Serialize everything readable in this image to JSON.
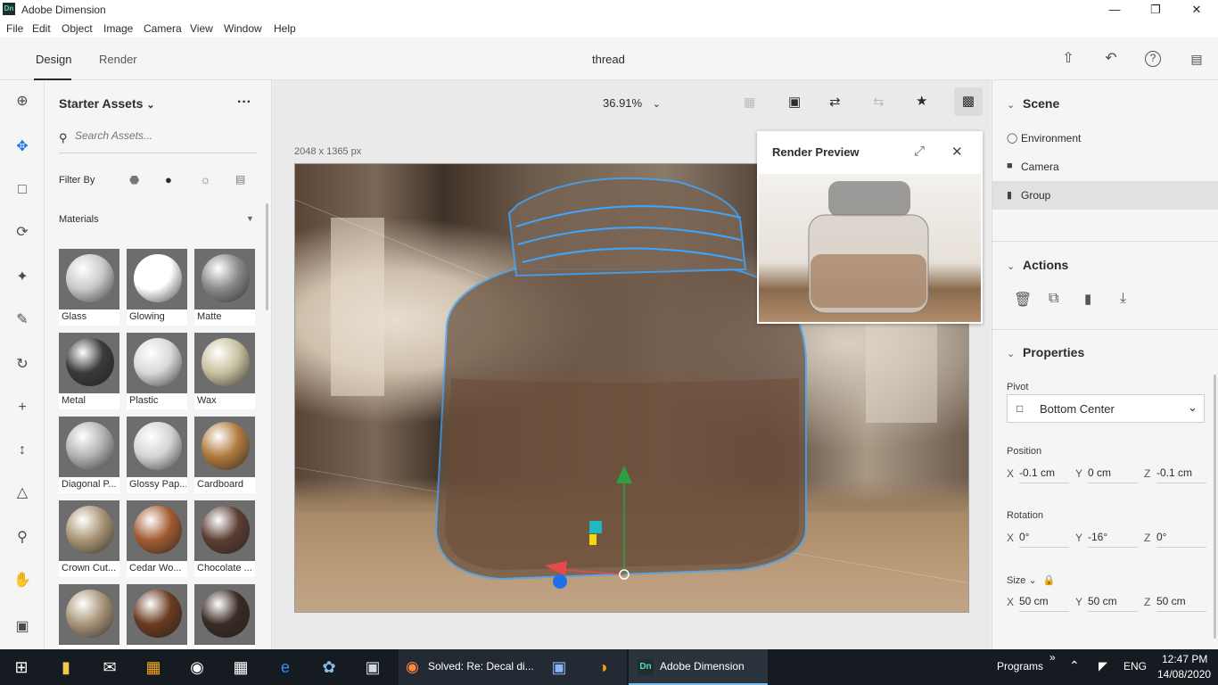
{
  "window": {
    "app_logo": "Dn",
    "title": "Adobe Dimension",
    "minimize_icon": "minimize-icon",
    "restore_icon": "restore-icon",
    "close_icon": "close-icon"
  },
  "menu": [
    "File",
    "Edit",
    "Object",
    "Image",
    "Camera",
    "View",
    "Window",
    "Help"
  ],
  "header": {
    "tabs": [
      "Design",
      "Render"
    ],
    "active_tab": "Design",
    "document_title": "thread",
    "icons": [
      "share-icon",
      "undo-icon",
      "help-icon",
      "comment-icon"
    ]
  },
  "tools": [
    "add-icon",
    "select-icon",
    "select-rect-icon",
    "orbit-icon",
    "magic-wand-icon",
    "eyedropper-icon",
    "rotate-icon",
    "move-icon",
    "scale-icon",
    "camera-orbit-icon",
    "zoom-icon",
    "hand-icon",
    "panel-toggle-icon"
  ],
  "assets": {
    "title": "Starter Assets",
    "more_label": "···",
    "search_placeholder": "Search Assets...",
    "filter_label": "Filter By",
    "filter_icons": [
      "model-filter-icon",
      "material-filter-icon",
      "light-filter-icon",
      "image-filter-icon"
    ],
    "section": "Materials",
    "materials": [
      {
        "label": "Glass",
        "color": "#c9c9c9"
      },
      {
        "label": "Glowing",
        "color": "#ffffff"
      },
      {
        "label": "Matte",
        "color": "#8a8a8a"
      },
      {
        "label": "Metal",
        "color": "#3a3a3a"
      },
      {
        "label": "Plastic",
        "color": "#d9d9d9"
      },
      {
        "label": "Wax",
        "color": "#c9c2a0"
      },
      {
        "label": "Diagonal P...",
        "color": "#b3b3b3"
      },
      {
        "label": "Glossy Pap...",
        "color": "#d4d4d4"
      },
      {
        "label": "Cardboard",
        "color": "#b07a3c"
      },
      {
        "label": "Crown Cut...",
        "color": "#a89474"
      },
      {
        "label": "Cedar Wo...",
        "color": "#a15a30"
      },
      {
        "label": "Chocolate ...",
        "color": "#5b3e32"
      },
      {
        "label": "",
        "color": "#a89478"
      },
      {
        "label": "",
        "color": "#6a3a20"
      },
      {
        "label": "",
        "color": "#3a2a24"
      }
    ]
  },
  "canvas": {
    "zoom": "36.91%",
    "size_label": "2048 x 1365 px",
    "toolbar_icons": [
      "frame-icon",
      "fit-icon",
      "camera-bookmark-icon",
      "camera-link-icon",
      "favorite-camera-icon",
      "render-preview-icon"
    ]
  },
  "render_preview": {
    "title": "Render Preview",
    "expand_icon": "expand-icon",
    "close_icon": "close-icon"
  },
  "scene": {
    "title": "Scene",
    "items": [
      "Environment",
      "Camera",
      "Group"
    ],
    "selected": "Group"
  },
  "actions": {
    "title": "Actions",
    "icons": [
      "delete-icon",
      "duplicate-icon",
      "group-icon",
      "download-icon"
    ]
  },
  "properties": {
    "title": "Properties",
    "pivot_label": "Pivot",
    "pivot_value": "Bottom Center",
    "position_label": "Position",
    "position": {
      "x": "-0.1 cm",
      "y": "0 cm",
      "z": "-0.1 cm"
    },
    "rotation_label": "Rotation",
    "rotation": {
      "x": "0°",
      "y": "-16°",
      "z": "0°"
    },
    "size_label": "Size",
    "size": {
      "x": "50 cm",
      "y": "50 cm",
      "z": "50 cm"
    },
    "axis": {
      "x": "X",
      "y": "Y",
      "z": "Z"
    }
  },
  "taskbar": {
    "apps": [
      "windows-start-icon",
      "file-explorer-icon",
      "mail-icon",
      "store-icon",
      "unreal-icon",
      "calendar-icon",
      "edge-icon",
      "paint-icon",
      "image-viewer-icon"
    ],
    "firefox_label": "Solved: Re: Decal di...",
    "dimension_label": "Adobe Dimension",
    "programs_label": "Programs",
    "chevron": "»",
    "lang": "ENG",
    "time": "12:47 PM",
    "date": "14/08/2020"
  }
}
